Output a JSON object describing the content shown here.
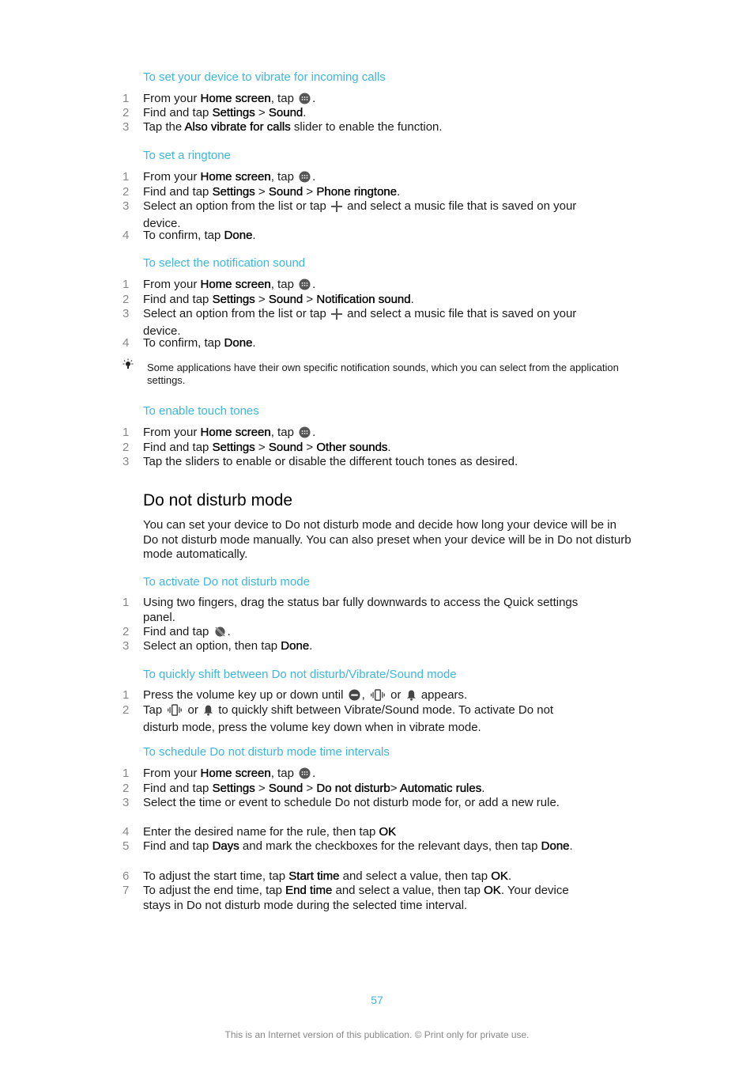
{
  "sections": [
    {
      "heading": "To set your device to vibrate for incoming calls",
      "steps": [
        {
          "n": "1",
          "parts": [
            [
              "From your ",
              0
            ],
            [
              "Home screen",
              1
            ],
            [
              ", tap ",
              0
            ],
            [
              "ICON:apps",
              0
            ],
            [
              ".",
              0
            ]
          ]
        },
        {
          "n": "2",
          "parts": [
            [
              "Find and tap ",
              0
            ],
            [
              "Settings",
              1
            ],
            [
              " > ",
              0
            ],
            [
              "Sound",
              1
            ],
            [
              ".",
              0
            ]
          ]
        },
        {
          "n": "3",
          "parts": [
            [
              "Tap the ",
              0
            ],
            [
              "Also vibrate for calls",
              1
            ],
            [
              " slider to enable the function.",
              0
            ]
          ]
        }
      ]
    },
    {
      "heading": "To set a ringtone",
      "steps": [
        {
          "n": "1",
          "parts": [
            [
              "From your ",
              0
            ],
            [
              "Home screen",
              1
            ],
            [
              ", tap ",
              0
            ],
            [
              "ICON:apps",
              0
            ],
            [
              ".",
              0
            ]
          ]
        },
        {
          "n": "2",
          "parts": [
            [
              "Find and tap ",
              0
            ],
            [
              "Settings",
              1
            ],
            [
              " > ",
              0
            ],
            [
              "Sound",
              1
            ],
            [
              " > ",
              0
            ],
            [
              "Phone ringtone",
              1
            ],
            [
              ".",
              0
            ]
          ]
        },
        {
          "n": "3",
          "parts": [
            [
              "Select an option from the list or tap ",
              0
            ],
            [
              "ICON:plus",
              0
            ],
            [
              " and select a music file that is saved on your device.",
              0
            ]
          ]
        },
        {
          "n": "4",
          "parts": [
            [
              "To confirm, tap ",
              0
            ],
            [
              "Done",
              1
            ],
            [
              ".",
              0
            ]
          ]
        }
      ]
    },
    {
      "heading": "To select the notification sound",
      "steps": [
        {
          "n": "1",
          "parts": [
            [
              "From your ",
              0
            ],
            [
              "Home screen",
              1
            ],
            [
              ", tap ",
              0
            ],
            [
              "ICON:apps",
              0
            ],
            [
              ".",
              0
            ]
          ]
        },
        {
          "n": "2",
          "parts": [
            [
              "Find and tap ",
              0
            ],
            [
              "Settings",
              1
            ],
            [
              " > ",
              0
            ],
            [
              "Sound",
              1
            ],
            [
              " > ",
              0
            ],
            [
              "Notification sound",
              1
            ],
            [
              ".",
              0
            ]
          ]
        },
        {
          "n": "3",
          "parts": [
            [
              "Select an option from the list or tap ",
              0
            ],
            [
              "ICON:plus",
              0
            ],
            [
              " and select a music file that is saved on your device.",
              0
            ]
          ]
        },
        {
          "n": "4",
          "parts": [
            [
              "To confirm, tap ",
              0
            ],
            [
              "Done",
              1
            ],
            [
              ".",
              0
            ]
          ]
        }
      ]
    },
    {
      "heading": "To enable touch tones",
      "steps": [
        {
          "n": "1",
          "parts": [
            [
              "From your ",
              0
            ],
            [
              "Home screen",
              1
            ],
            [
              ", tap ",
              0
            ],
            [
              "ICON:apps",
              0
            ],
            [
              ".",
              0
            ]
          ]
        },
        {
          "n": "2",
          "parts": [
            [
              "Find and tap ",
              0
            ],
            [
              "Settings",
              1
            ],
            [
              " > ",
              0
            ],
            [
              "Sound",
              1
            ],
            [
              " > ",
              0
            ],
            [
              "Other sounds",
              1
            ],
            [
              ".",
              0
            ]
          ]
        },
        {
          "n": "3",
          "parts": [
            [
              "Tap the sliders to enable or disable the different touch tones as desired.",
              0
            ]
          ]
        }
      ]
    },
    {
      "heading": "To activate Do not disturb mode",
      "steps": [
        {
          "n": "1",
          "parts": [
            [
              "Using two fingers, drag the status bar fully downwards to access the Quick settings panel.",
              0
            ]
          ]
        },
        {
          "n": "2",
          "parts": [
            [
              "Find and tap ",
              0
            ],
            [
              "ICON:dnd",
              0
            ],
            [
              ".",
              0
            ]
          ]
        },
        {
          "n": "3",
          "parts": [
            [
              "Select an option, then tap ",
              0
            ],
            [
              "Done",
              1
            ],
            [
              ".",
              0
            ]
          ]
        }
      ]
    },
    {
      "heading": "To quickly shift between Do not disturb/Vibrate/Sound mode",
      "steps": [
        {
          "n": "1",
          "parts": [
            [
              "Press the volume key up or down until ",
              0
            ],
            [
              "ICON:minus-circle",
              0
            ],
            [
              ", ",
              0
            ],
            [
              "ICON:vibrate",
              0
            ],
            [
              " or ",
              0
            ],
            [
              "ICON:bell",
              0
            ],
            [
              " appears.",
              0
            ]
          ]
        },
        {
          "n": "2",
          "parts": [
            [
              "Tap ",
              0
            ],
            [
              "ICON:vibrate",
              0
            ],
            [
              " or ",
              0
            ],
            [
              "ICON:bell",
              0
            ],
            [
              " to quickly shift between Vibrate/Sound mode. To activate Do not disturb mode, press the volume key down when in vibrate mode.",
              0
            ]
          ]
        }
      ]
    },
    {
      "heading": "To schedule Do not disturb mode time intervals",
      "steps": [
        {
          "n": "1",
          "parts": [
            [
              "From your ",
              0
            ],
            [
              "Home screen",
              1
            ],
            [
              ", tap ",
              0
            ],
            [
              "ICON:apps",
              0
            ],
            [
              ".",
              0
            ]
          ]
        },
        {
          "n": "2",
          "parts": [
            [
              "Find and tap ",
              0
            ],
            [
              "Settings",
              1
            ],
            [
              " > ",
              0
            ],
            [
              "Sound",
              1
            ],
            [
              " > ",
              0
            ],
            [
              "Do not disturb",
              1
            ],
            [
              "> ",
              0
            ],
            [
              "Automatic rules",
              1
            ],
            [
              ".",
              0
            ]
          ]
        },
        {
          "n": "3",
          "parts": [
            [
              "Select the time or event to schedule Do not disturb mode for, or add a new rule.",
              0
            ]
          ]
        },
        {
          "n": "4",
          "parts": [
            [
              "Enter the desired name for the rule, then tap ",
              0
            ],
            [
              "OK",
              1
            ]
          ]
        },
        {
          "n": "5",
          "parts": [
            [
              "Find and tap ",
              0
            ],
            [
              "Days",
              1
            ],
            [
              " and mark the checkboxes for the relevant days, then tap ",
              0
            ],
            [
              "Done",
              1
            ],
            [
              ".",
              0
            ]
          ]
        },
        {
          "n": "6",
          "parts": [
            [
              "To adjust the start time, tap ",
              0
            ],
            [
              "Start time",
              1
            ],
            [
              " and select a value, then tap ",
              0
            ],
            [
              "OK",
              1
            ],
            [
              ".",
              0
            ]
          ]
        },
        {
          "n": "7",
          "parts": [
            [
              "To adjust the end time, tap ",
              0
            ],
            [
              "End time",
              1
            ],
            [
              " and select a value, then tap ",
              0
            ],
            [
              "OK",
              1
            ],
            [
              ". Your device stays in Do not disturb mode during the selected time interval.",
              0
            ]
          ]
        }
      ]
    }
  ],
  "tip": "Some applications have their own specific notification sounds, which you can select from the application settings.",
  "chapter": {
    "title": "Do not disturb mode",
    "intro": "You can set your device to Do not disturb mode and decide how long your device will be in Do not disturb mode manually. You can also preset when your device will be in Do not disturb mode automatically."
  },
  "page_number": "57",
  "footer": "This is an Internet version of this publication. © Print only for private use.",
  "colors": {
    "heading": "#3db6e0",
    "step_number": "#888888",
    "footer": "#888888"
  }
}
